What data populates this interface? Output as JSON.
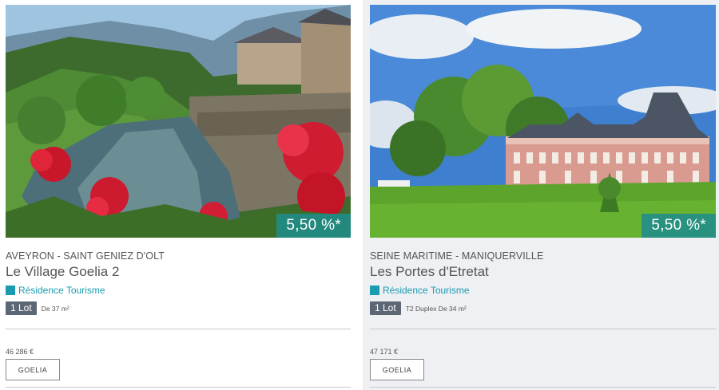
{
  "listings": [
    {
      "rate": "5,50 %*",
      "location": "AVEYRON - SAINT GENIEZ D'OLT",
      "title": "Le Village Goelia 2",
      "property_type": "Résidence Tourisme",
      "lot_badge": "1 Lot",
      "lot_desc": "De 37 m²",
      "price": "46 286 €",
      "brand_button": "GOELIA",
      "image_subject": "river-village-red-geraniums"
    },
    {
      "rate": "5,50 %*",
      "location": "SEINE MARITIME - MANIQUERVILLE",
      "title": "Les Portes d'Etretat",
      "property_type": "Résidence Tourisme",
      "lot_badge": "1 Lot",
      "lot_desc": "T2 Duplex De 34 m²",
      "price": "47 171 €",
      "brand_button": "GOELIA",
      "image_subject": "chateau-lawn-trees"
    }
  ],
  "colors": {
    "rate_badge": "#208c8a",
    "type_accent": "#1a9bb0",
    "lot_badge": "#5d6675",
    "card_right_bg": "#eef0f3"
  }
}
